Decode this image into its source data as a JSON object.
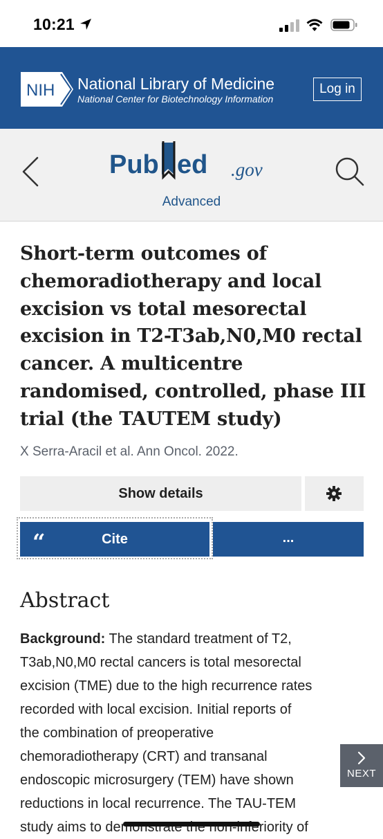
{
  "status_bar": {
    "time": "10:21",
    "icons": [
      "location-arrow-icon",
      "cellular-signal-icon",
      "wifi-icon",
      "battery-icon"
    ]
  },
  "nih_banner": {
    "logo_text": "NIH",
    "title": "National Library of Medicine",
    "subtitle": "National Center for Biotechnology Information",
    "login_label": "Log in",
    "background_color": "#205493"
  },
  "pubmed_header": {
    "logo_text_left": "Pub",
    "logo_text_right": "Med",
    "logo_domain": ".gov",
    "advanced_label": "Advanced",
    "icons": [
      "back-chevron-icon",
      "search-icon"
    ]
  },
  "article": {
    "title_lines": [
      "Short-term outcomes of",
      "chemoradiotherapy and local",
      "excision vs total mesorectal",
      "excision in T2-T3ab,N0,M0 rectal",
      "cancer. A multicentre",
      "randomised, controlled, phase III",
      "trial (the TAUTEM study)"
    ],
    "authors_line": "X Serra-Aracil et al. Ann Oncol. 2022."
  },
  "actions": {
    "show_details_label": "Show details",
    "cite_label": "Cite",
    "more_label": "...",
    "accent_color": "#205493"
  },
  "abstract": {
    "heading": "Abstract",
    "label": "Background:",
    "first_line_rest": " The standard treatment of T2,",
    "lines": [
      "T3ab,N0,M0 rectal cancers is total mesorectal",
      "excision (TME) due to the high recurrence rates",
      "recorded with local excision. Initial reports of",
      "the combination of preoperative",
      "chemoradiotherapy (CRT) and transanal",
      "endoscopic microsurgery (TEM) have shown",
      "reductions in local recurrence. The TAU-TEM",
      "study aims to demonstrate the non-inferiority of"
    ]
  },
  "next_button": {
    "label": "NEXT"
  }
}
